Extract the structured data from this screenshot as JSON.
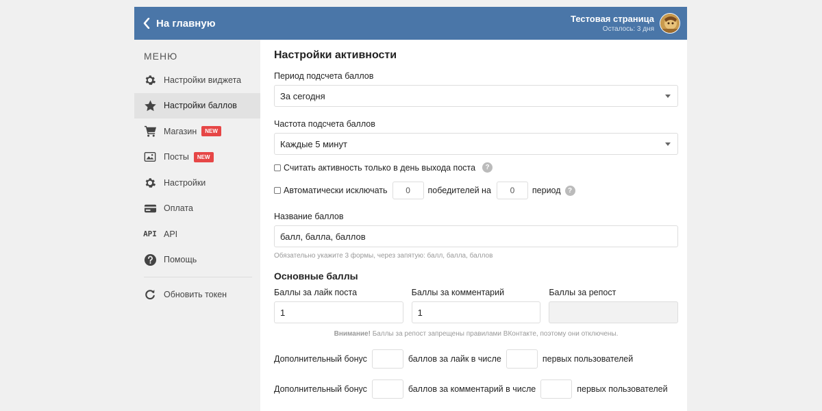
{
  "header": {
    "back_label": "На главную",
    "account_name": "Тестовая страница",
    "account_sub": "Осталось: 3 дня"
  },
  "sidebar": {
    "title": "МЕНЮ",
    "items": [
      {
        "label": "Настройки виджета",
        "icon": "gear-icon"
      },
      {
        "label": "Настройки баллов",
        "icon": "star-icon",
        "active": true
      },
      {
        "label": "Магазин",
        "icon": "cart-icon",
        "badge": "NEW"
      },
      {
        "label": "Посты",
        "icon": "image-icon",
        "badge": "NEW"
      },
      {
        "label": "Настройки",
        "icon": "gear-icon"
      },
      {
        "label": "Оплата",
        "icon": "card-icon"
      },
      {
        "label": "API",
        "icon": "api-icon",
        "icon_text": "API"
      },
      {
        "label": "Помощь",
        "icon": "help-icon"
      }
    ],
    "refresh_label": "Обновить токен"
  },
  "main": {
    "title": "Настройки активности",
    "period": {
      "label": "Период подсчета баллов",
      "value": "За сегодня"
    },
    "frequency": {
      "label": "Частота подсчета баллов",
      "value": "Каждые 5 минут"
    },
    "only_post_day": {
      "label": "Считать активность только в день выхода поста",
      "checked": false
    },
    "auto_exclude": {
      "label": "Автоматически исключать",
      "winners_value": "0",
      "winners_label": "победителей на",
      "period_value": "0",
      "period_label": "период",
      "checked": false
    },
    "points_name": {
      "label": "Название баллов",
      "value": "балл, балла, баллов",
      "hint": "Обязательно укажите 3 формы, через запятую: балл, балла, баллов"
    },
    "basic": {
      "title": "Основные баллы",
      "like_label": "Баллы за лайк поста",
      "like_value": "1",
      "comment_label": "Баллы за комментарий",
      "comment_value": "1",
      "repost_label": "Баллы за репост",
      "repost_value": "",
      "warning_bold": "Внимание!",
      "warning_text": " Баллы за репост запрещены правилами ВКонтакте, поэтому они отключены."
    },
    "bonus_like": {
      "prefix": "Дополнительный бонус",
      "middle": "баллов за лайк в числе",
      "suffix": "первых пользователей",
      "value1": "",
      "value2": ""
    },
    "bonus_comment": {
      "prefix": "Дополнительный бонус",
      "middle": "баллов за комментарий в числе",
      "suffix": "первых пользователей",
      "value1": "",
      "value2": ""
    }
  },
  "colors": {
    "header": "#4a76a8",
    "badge": "#e64646",
    "sidebar_bg": "#f0f0f0"
  }
}
